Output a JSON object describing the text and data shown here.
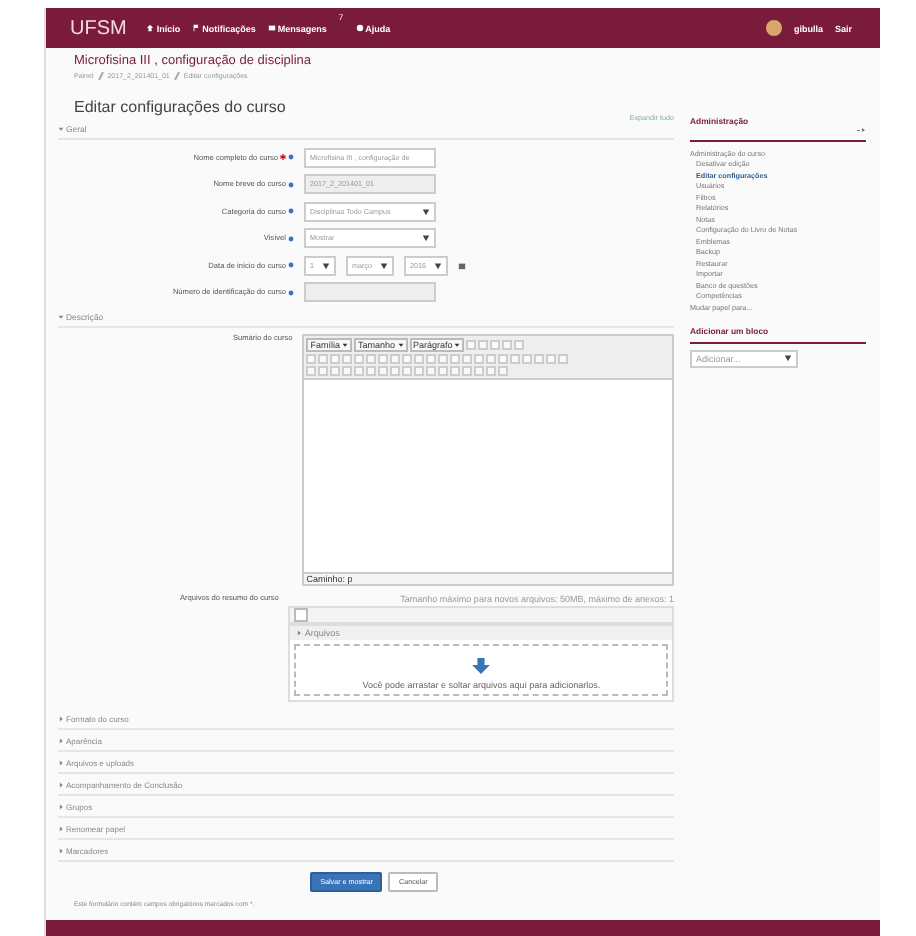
{
  "navbar": {
    "brand": "UFSM",
    "links": [
      {
        "label": "Início"
      },
      {
        "label": "Notificações"
      },
      {
        "label": "Mensagens",
        "badge": "7"
      },
      {
        "label": "Ajuda"
      }
    ],
    "user": "gibulla",
    "logout": "Sair"
  },
  "course_title": "Microfisina III , configuração de disciplina",
  "breadcrumb": [
    "Painel",
    "2017_2_201401_01",
    "Editar configurações"
  ],
  "page_title": "Editar configurações do curso",
  "expand_all": "Expandir tudo",
  "general": {
    "legend": "Geral",
    "fields": [
      {
        "label": "Nome completo do curso",
        "required": true,
        "kind": "text",
        "value": "Microfisina III , configuração de"
      },
      {
        "label": "Nome breve do curso",
        "required": false,
        "kind": "readonly",
        "value": "2017_2_201401_01"
      },
      {
        "label": "Categoria do curso",
        "required": false,
        "kind": "select",
        "value": "Disciplinas Todo Campus"
      },
      {
        "label": "Visível",
        "required": false,
        "kind": "select",
        "value": "Mostrar"
      },
      {
        "label": "Data de início do curso",
        "required": false,
        "kind": "date",
        "selects": [
          "1",
          "março",
          "2016"
        ]
      },
      {
        "label": "Número de identificação do curso",
        "required": false,
        "kind": "readonly"
      }
    ]
  },
  "description": {
    "legend": "Descrição",
    "summary_label": "Sumário do curso",
    "editor_menus": [
      "Família",
      "Tamanho",
      "Parágrafo"
    ],
    "path": "Caminho: p"
  },
  "files": {
    "label": "Arquivos do resumo do curso",
    "limit": "Tamanho máximo para novos arquivos: 50MB, máximo de anexos: 1",
    "folder": "Arquivos",
    "drop_hint": "Você pode arrastar e soltar arquivos aqui para adicionarlos."
  },
  "sections": [
    "Formato do curso",
    "Aparência",
    "Arquivos e uploads",
    "Acompanhamento de Conclusão",
    "Grupos",
    "Renomear papel",
    "Marcadores"
  ],
  "buttons": [
    {
      "label": "Salvar e mostrar",
      "kind": "primary"
    },
    {
      "label": "Cancelar",
      "kind": "secondary"
    }
  ],
  "required_note": "Este formulário contém campos obrigatórios marcados com *.",
  "sidebar": {
    "title": "Administração",
    "items": [
      {
        "label": "Administração do curso",
        "selected": false,
        "indent": false
      },
      {
        "label": "Desativar edição",
        "selected": false,
        "indent": true
      },
      {
        "label": "Editar configurações",
        "selected": true,
        "indent": true
      },
      {
        "label": "Usuários",
        "selected": false,
        "indent": true
      },
      {
        "label": "Filtros",
        "selected": false,
        "indent": true
      },
      {
        "label": "Relatórios",
        "selected": false,
        "indent": true
      },
      {
        "label": "Notas",
        "selected": false,
        "indent": true
      },
      {
        "label": "Configuração do Livro de Notas",
        "selected": false,
        "indent": true
      },
      {
        "label": "Emblemas",
        "selected": false,
        "indent": true
      },
      {
        "label": "Backup",
        "selected": false,
        "indent": true
      },
      {
        "label": "Restaurar",
        "selected": false,
        "indent": true
      },
      {
        "label": "Importar",
        "selected": false,
        "indent": true
      },
      {
        "label": "Banco de questões",
        "selected": false,
        "indent": true
      },
      {
        "label": "Competências",
        "selected": false,
        "indent": true
      },
      {
        "label": "Mudar papel para...",
        "selected": false,
        "indent": false
      }
    ],
    "add_block": "Adicionar um bloco",
    "add_select": "Adicionar..."
  }
}
